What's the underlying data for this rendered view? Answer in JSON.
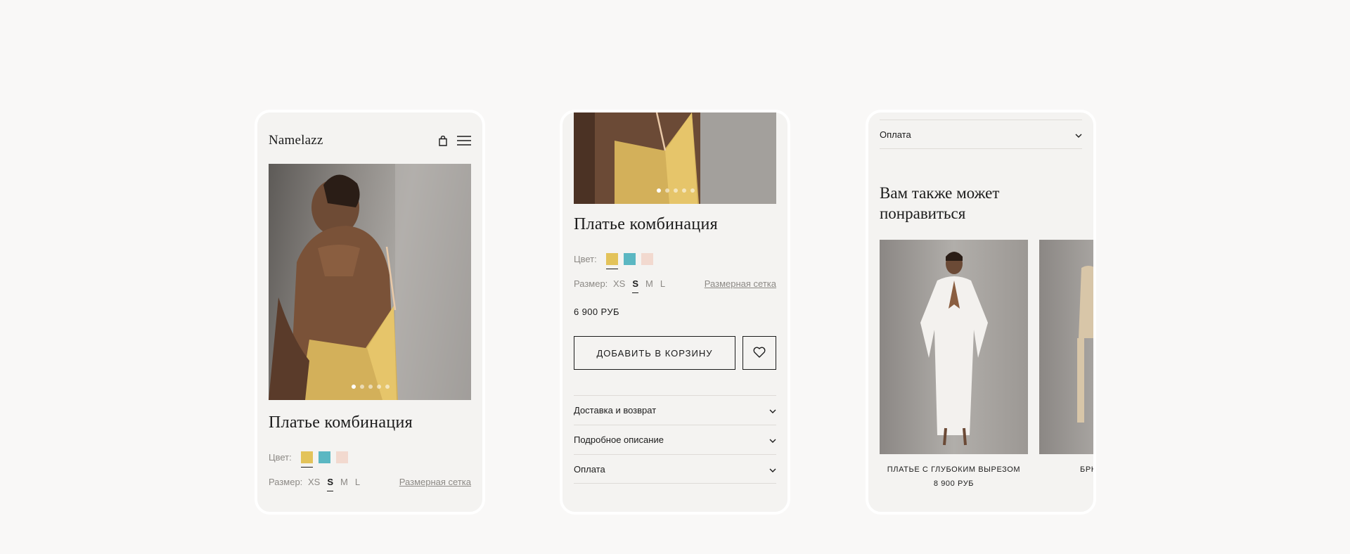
{
  "brand": "Namelazz",
  "product": {
    "title": "Платье комбинация",
    "color_label": "Цвет:",
    "colors": [
      "#e3c35a",
      "#5bb7c2",
      "#f2d9cf"
    ],
    "size_label": "Размер:",
    "sizes": [
      "XS",
      "S",
      "M",
      "L"
    ],
    "selected_size": "S",
    "size_chart": "Размерная сетка",
    "price": "6 900 РУБ",
    "add_to_cart": "ДОБАВИТЬ В КОРЗИНУ",
    "gallery_dots": 5,
    "gallery_active": 1
  },
  "accordion": [
    {
      "label": "Доставка и возврат"
    },
    {
      "label": "Подробное описание"
    },
    {
      "label": "Оплата"
    }
  ],
  "recommendations": {
    "title_line1": "Вам также может",
    "title_line2": "понравиться",
    "items": [
      {
        "name": "ПЛАТЬЕ С ГЛУБОКИМ ВЫРЕЗОМ",
        "price": "8 900 РУБ"
      },
      {
        "name": "БРЮ",
        "price": ""
      }
    ]
  },
  "icons": {
    "bag": "shopping-bag-icon",
    "menu": "hamburger-menu-icon",
    "heart": "heart-icon",
    "chevron": "chevron-down-icon"
  }
}
